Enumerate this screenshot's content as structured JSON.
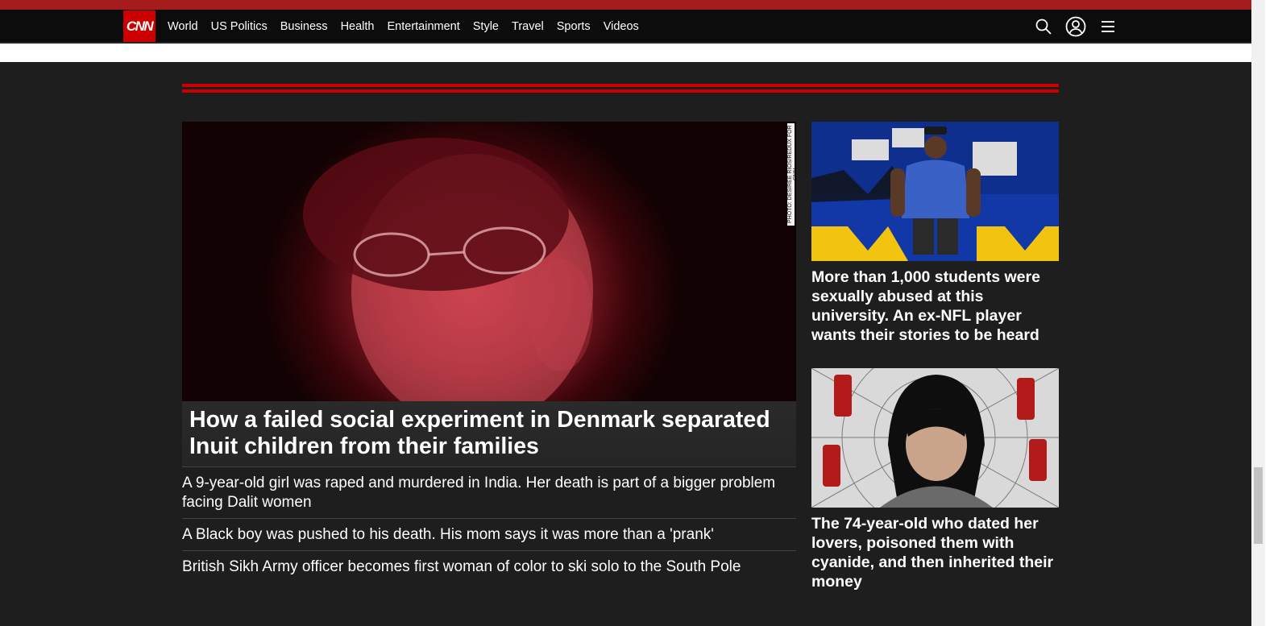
{
  "nav": {
    "logo": "CNN",
    "links": [
      "World",
      "US Politics",
      "Business",
      "Health",
      "Entertainment",
      "Style",
      "Travel",
      "Sports",
      "Videos"
    ],
    "icons": [
      "search-icon",
      "account-icon",
      "menu-icon"
    ]
  },
  "hero": {
    "headline": "How a failed social experiment in Denmark separated Inuit children from their families",
    "photo_credit": "PHOTO: DESIREE RIOS/REDUX FOR CNN"
  },
  "stories": [
    "A 9-year-old girl was raped and murdered in India. Her death is part of a bigger problem facing Dalit women",
    "A Black boy was pushed to his death. His mom says it was more than a 'prank'",
    "British Sikh Army officer becomes first woman of color to ski solo to the South Pole"
  ],
  "side": [
    {
      "headline": "More than 1,000 students were sexually abused at this university. An ex-NFL player wants their stories to be heard"
    },
    {
      "headline": "The 74-year-old who dated her lovers, poisoned them with cyanide, and then inherited their money"
    }
  ],
  "colors": {
    "brand": "#cc0000",
    "background": "#1e1e1e",
    "nav": "#0c0c0c"
  }
}
